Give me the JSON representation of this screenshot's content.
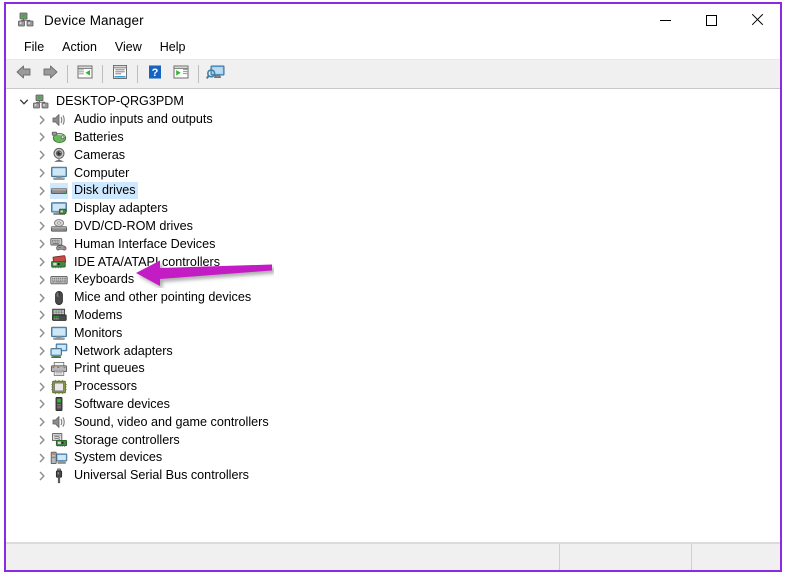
{
  "window": {
    "title": "Device Manager",
    "app_icon": "device-manager-icon",
    "border_color": "#8a2be2",
    "controls": {
      "minimize": "minimize-button",
      "maximize": "maximize-button",
      "close": "close-button"
    }
  },
  "menubar": {
    "items": [
      {
        "label": "File"
      },
      {
        "label": "Action"
      },
      {
        "label": "View"
      },
      {
        "label": "Help"
      }
    ]
  },
  "toolbar": {
    "buttons": [
      {
        "icon": "back-arrow-icon",
        "title": "Back"
      },
      {
        "icon": "forward-arrow-icon",
        "title": "Forward"
      },
      {
        "icon": "show-hide-console-tree-icon",
        "title": "Show/Hide Console Tree"
      },
      {
        "icon": "properties-icon",
        "title": "Properties"
      },
      {
        "icon": "help-icon",
        "title": "Help"
      },
      {
        "icon": "update-driver-icon",
        "title": "Update driver"
      },
      {
        "icon": "scan-for-hardware-changes-icon",
        "title": "Scan for hardware changes"
      }
    ]
  },
  "tree": {
    "root": {
      "label": "DESKTOP-QRG3PDM",
      "icon": "computer-root-icon",
      "expanded": true
    },
    "items": [
      {
        "label": "Audio inputs and outputs",
        "icon": "speaker-icon",
        "selected": false
      },
      {
        "label": "Batteries",
        "icon": "battery-icon",
        "selected": false
      },
      {
        "label": "Cameras",
        "icon": "camera-icon",
        "selected": false
      },
      {
        "label": "Computer",
        "icon": "monitor-icon",
        "selected": false
      },
      {
        "label": "Disk drives",
        "icon": "disk-drive-icon",
        "selected": true
      },
      {
        "label": "Display adapters",
        "icon": "display-adapter-icon",
        "selected": false
      },
      {
        "label": "DVD/CD-ROM drives",
        "icon": "optical-drive-icon",
        "selected": false
      },
      {
        "label": "Human Interface Devices",
        "icon": "hid-icon",
        "selected": false
      },
      {
        "label": "IDE ATA/ATAPI controllers",
        "icon": "ide-controller-icon",
        "selected": false
      },
      {
        "label": "Keyboards",
        "icon": "keyboard-icon",
        "selected": false
      },
      {
        "label": "Mice and other pointing devices",
        "icon": "mouse-icon",
        "selected": false
      },
      {
        "label": "Modems",
        "icon": "modem-icon",
        "selected": false
      },
      {
        "label": "Monitors",
        "icon": "monitor-icon",
        "selected": false
      },
      {
        "label": "Network adapters",
        "icon": "network-adapter-icon",
        "selected": false
      },
      {
        "label": "Print queues",
        "icon": "printer-icon",
        "selected": false
      },
      {
        "label": "Processors",
        "icon": "processor-icon",
        "selected": false
      },
      {
        "label": "Software devices",
        "icon": "software-device-icon",
        "selected": false
      },
      {
        "label": "Sound, video and game controllers",
        "icon": "speaker-icon",
        "selected": false
      },
      {
        "label": "Storage controllers",
        "icon": "storage-controller-icon",
        "selected": false
      },
      {
        "label": "System devices",
        "icon": "system-device-icon",
        "selected": false
      },
      {
        "label": "Universal Serial Bus controllers",
        "icon": "usb-icon",
        "selected": false
      }
    ]
  },
  "statusbar": {
    "panes": [
      {
        "text": ""
      },
      {
        "text": ""
      },
      {
        "text": ""
      }
    ]
  },
  "annotation": {
    "type": "arrow",
    "direction": "left",
    "color": "#c41ac4",
    "points_at": "Disk drives"
  }
}
